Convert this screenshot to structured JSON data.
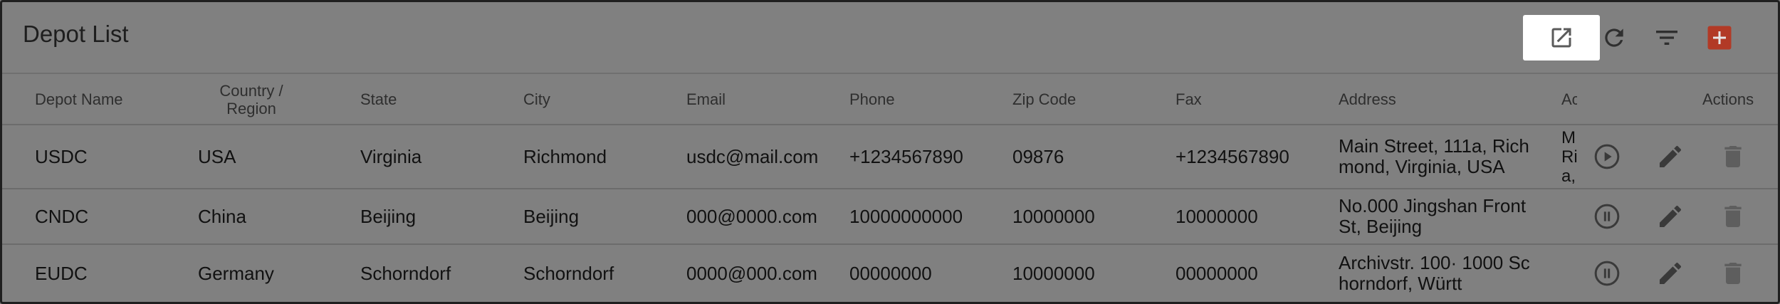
{
  "header": {
    "title": "Depot List",
    "tools": [
      {
        "name": "open-in-new-icon"
      },
      {
        "name": "refresh-icon"
      },
      {
        "name": "filter-icon"
      },
      {
        "name": "add-icon"
      }
    ]
  },
  "columns": {
    "depot_name": "Depot Name",
    "country_line1": "Country /",
    "country_line2": "Region",
    "state": "State",
    "city": "City",
    "email": "Email",
    "phone": "Phone",
    "zip": "Zip Code",
    "fax": "Fax",
    "address": "Address",
    "address2": "Ac",
    "actions": "Actions"
  },
  "rows": [
    {
      "depot_name": "USDC",
      "country": "USA",
      "state": "Virginia",
      "city": "Richmond",
      "email": "usdc@mail.com",
      "phone": "+1234567890",
      "zip": "09876",
      "fax": "+1234567890",
      "address_l1": "Main Street, 111a, Rich",
      "address_l2": "mond, Virginia, USA",
      "addr2_l1": "M",
      "addr2_l2": "Ri",
      "addr2_l3": "a,",
      "status": "play"
    },
    {
      "depot_name": "CNDC",
      "country": "China",
      "state": "Beijing",
      "city": "Beijing",
      "email": "000@0000.com",
      "phone": "10000000000",
      "zip": "10000000",
      "fax": "10000000",
      "address_l1": "No.000 Jingshan Front",
      "address_l2": "St, Beijing",
      "addr2_l1": "",
      "addr2_l2": "",
      "addr2_l3": "",
      "status": "pause"
    },
    {
      "depot_name": "EUDC",
      "country": "Germany",
      "state": "Schorndorf",
      "city": "Schorndorf",
      "email": "0000@000.com",
      "phone": "00000000",
      "zip": "10000000",
      "fax": "00000000",
      "address_l1": "Archivstr. 100· 1000 Sc",
      "address_l2": "horndorf, Württ",
      "addr2_l1": "",
      "addr2_l2": "",
      "addr2_l3": "",
      "status": "pause"
    }
  ],
  "colors": {
    "overlay": "#808080",
    "add_button": "#b23a26",
    "highlight": "#ffffff"
  }
}
